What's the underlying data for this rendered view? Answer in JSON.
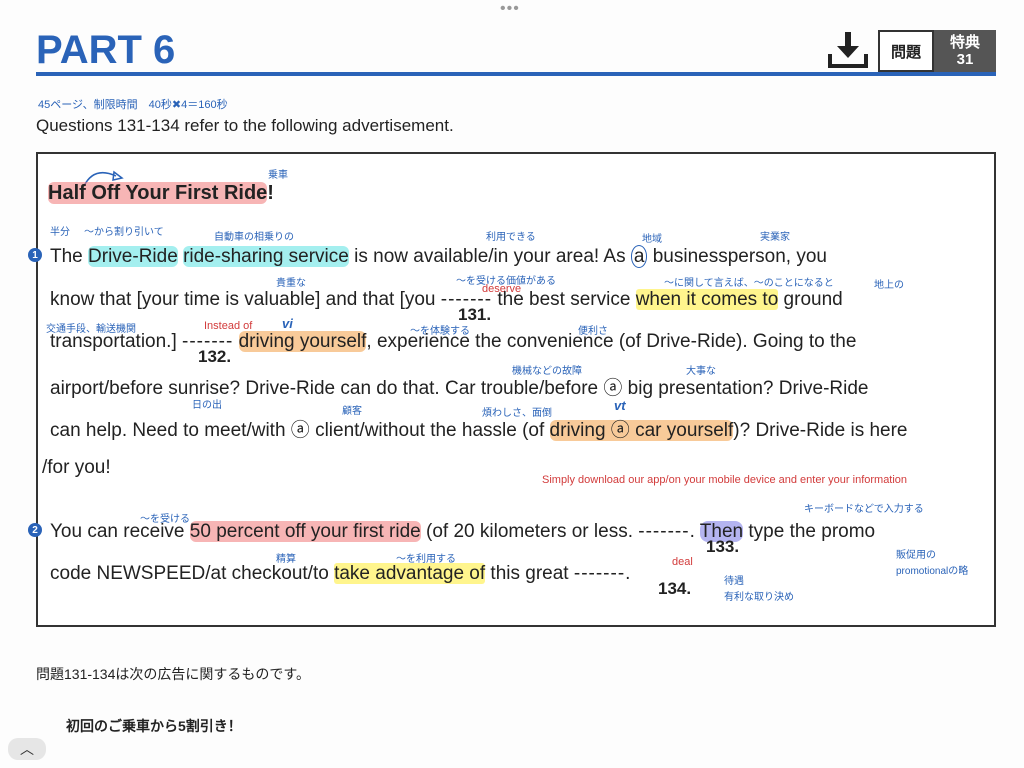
{
  "header": {
    "part_title": "PART 6",
    "tab_mondai": "問題",
    "tab_tokuten": "特典",
    "tab_number": "31",
    "time_note": "45ページ、制限時間　40秒✖4＝160秒",
    "questions_line": "Questions 131-134 refer to the following advertisement."
  },
  "ad": {
    "title": "Half Off Your First Ride",
    "title_bang": "!",
    "line1": [
      "The ",
      "Drive-Ride",
      " ",
      "ride-sharing service",
      " is now available/in your area! As ",
      "a",
      " businessperson, you"
    ],
    "line2": [
      "know that [your time is valuable] and that [you ",
      "-------",
      " the best service ",
      "when it comes to",
      " ground"
    ],
    "line3": [
      "transportation.] ",
      "-------",
      " ",
      "driving yourself",
      ", experience the convenience (of Drive-Ride). Going to the"
    ],
    "line4": "airport/before sunrise? Drive-Ride can do that. Car trouble/before ⓐ big presentation? Drive-Ride",
    "line5": [
      "can help. Need to meet/with ⓐ client/without the hassle (of ",
      "driving ⓐ car yourself",
      ")? Drive-Ride is here"
    ],
    "line6": "/for you!",
    "line7": [
      "You can receive ",
      "50 percent off your first ride",
      " (of 20 kilometers or less. ",
      "-------",
      ". ",
      "Then",
      " type the promo"
    ],
    "line8": [
      "code NEWSPEED/at checkout/to ",
      "take advantage of",
      " this great ",
      "-------",
      "."
    ],
    "q131": "131.",
    "q132": "132.",
    "q133": "133.",
    "q134": "134.",
    "para1": "1",
    "para2": "2"
  },
  "annotations": {
    "jousha": "乗車",
    "hanbun": "半分",
    "waribiki": "〜から割り引いて",
    "aisou": "自動車の相乗りの",
    "riyou": "利用できる",
    "chiiki": "地域",
    "jitsugyouka": "実業家",
    "kichou": "貴重な",
    "atai": "〜を受ける価値がある",
    "deserve": "deserve",
    "kanshite": "〜に関して言えば、〜のことになると",
    "chijou": "地上の",
    "koutsuu": "交通手段、輸送機関",
    "instead": "Instead of",
    "vi": "vi",
    "taiken": "〜を体験する",
    "benri": "便利さ",
    "koshou": "機械などの故障",
    "daiji": "大事な",
    "hinode": "日の出",
    "kokyaku": "顧客",
    "wazurawashisa": "煩わしさ、面倒",
    "vt": "vt",
    "simply": "Simply download our app/on your mobile device and enter your information",
    "keyboard": "キーボードなどで入力する",
    "ukeru": "〜を受ける",
    "hanbaku": "販促用の",
    "promotional": "promotionalの略",
    "seisan": "精算",
    "riyou2": "〜を利用する",
    "deal": "deal",
    "taigu": "待遇",
    "yuuri": "有利な取り決め"
  },
  "translation": {
    "intro": "問題131-134は次の広告に関するものです。",
    "title": "初回のご乗車から5割引き！"
  },
  "colors": {
    "accent": "#2a63b8",
    "highlight_red": "#f07878",
    "highlight_cyan": "#5ae1e1",
    "highlight_yellow": "#fff050",
    "highlight_orange": "#f5b46e",
    "highlight_purple": "#8282e6"
  },
  "icons": {
    "download": "download-icon",
    "toggle": "chevron-up-icon"
  }
}
